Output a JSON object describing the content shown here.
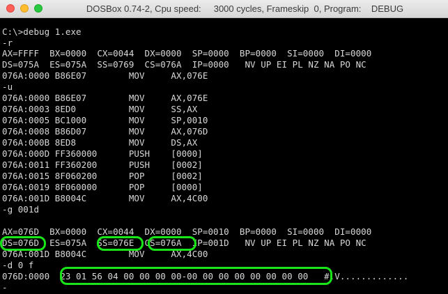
{
  "window": {
    "title": "DOSBox 0.74-2, Cpu speed:     3000 cycles, Frameskip  0, Program:    DEBUG"
  },
  "icons": {
    "close": "close-traffic-light-icon",
    "minimize": "minimize-traffic-light-icon",
    "zoom": "zoom-traffic-light-icon",
    "accent_colors": {
      "close": "#fe5f57",
      "minimize": "#febc2e",
      "zoom": "#28c840",
      "highlight": "#19e619"
    }
  },
  "terminal": {
    "lines": [
      "",
      "C:\\>debug 1.exe",
      "-r",
      "AX=FFFF  BX=0000  CX=0044  DX=0000  SP=0000  BP=0000  SI=0000  DI=0000",
      "DS=075A  ES=075A  SS=0769  CS=076A  IP=0000   NV UP EI PL NZ NA PO NC",
      "076A:0000 B86E07        MOV     AX,076E",
      "-u",
      "076A:0000 B86E07        MOV     AX,076E",
      "076A:0003 8ED0          MOV     SS,AX",
      "076A:0005 BC1000        MOV     SP,0010",
      "076A:0008 B86D07        MOV     AX,076D",
      "076A:000B 8ED8          MOV     DS,AX",
      "076A:000D FF360000      PUSH    [0000]",
      "076A:0011 FF360200      PUSH    [0002]",
      "076A:0015 8F060200      POP     [0002]",
      "076A:0019 8F060000      POP     [0000]",
      "076A:001D B8004C        MOV     AX,4C00",
      "-g 001d",
      "",
      "AX=076D  BX=0000  CX=0044  DX=0000  SP=0010  BP=0000  SI=0000  DI=0000",
      "DS=076D  ES=075A  SS=076E  CS=076A  IP=001D   NV UP EI PL NZ NA PO NC",
      "076A:001D B8004C        MOV     AX,4C00",
      "-d 0 f",
      "076D:0000  23 01 56 04 00 00 00 00-00 00 00 00 00 00 00 00   #.V.............",
      "-"
    ]
  }
}
